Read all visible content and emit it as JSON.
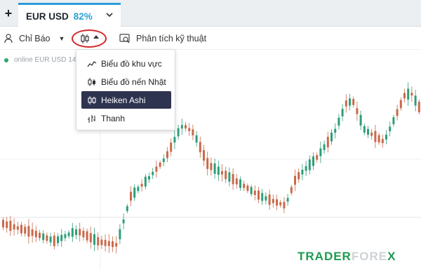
{
  "tabbar": {
    "add_label": "+",
    "active_tab": {
      "symbol": "EUR USD",
      "percent": "82%"
    }
  },
  "toolbar": {
    "indicators_label": "Chỉ Báo",
    "technical_analysis_label": "Phân tích kỹ thuật"
  },
  "chart_legend": "online EUR USD 14",
  "chart_type_menu": {
    "items": [
      {
        "label": "Biểu đồ khu vực",
        "icon": "area-chart-icon"
      },
      {
        "label": "Biểu đồ nến Nhật",
        "icon": "candlestick-icon"
      },
      {
        "label": "Heiken Ashi",
        "icon": "heiken-ashi-icon",
        "selected": true
      },
      {
        "label": "Thanh",
        "icon": "bar-chart-icon"
      }
    ]
  },
  "watermark": {
    "part1": "TRADER",
    "part2": "FORE",
    "part3": "X"
  },
  "colors": {
    "bull": "#2e9e78",
    "bear": "#c9694a",
    "menu_selected_bg": "#2e3350",
    "tab_accent": "#2d9cdb",
    "highlight_ring": "#d62b2b"
  }
}
